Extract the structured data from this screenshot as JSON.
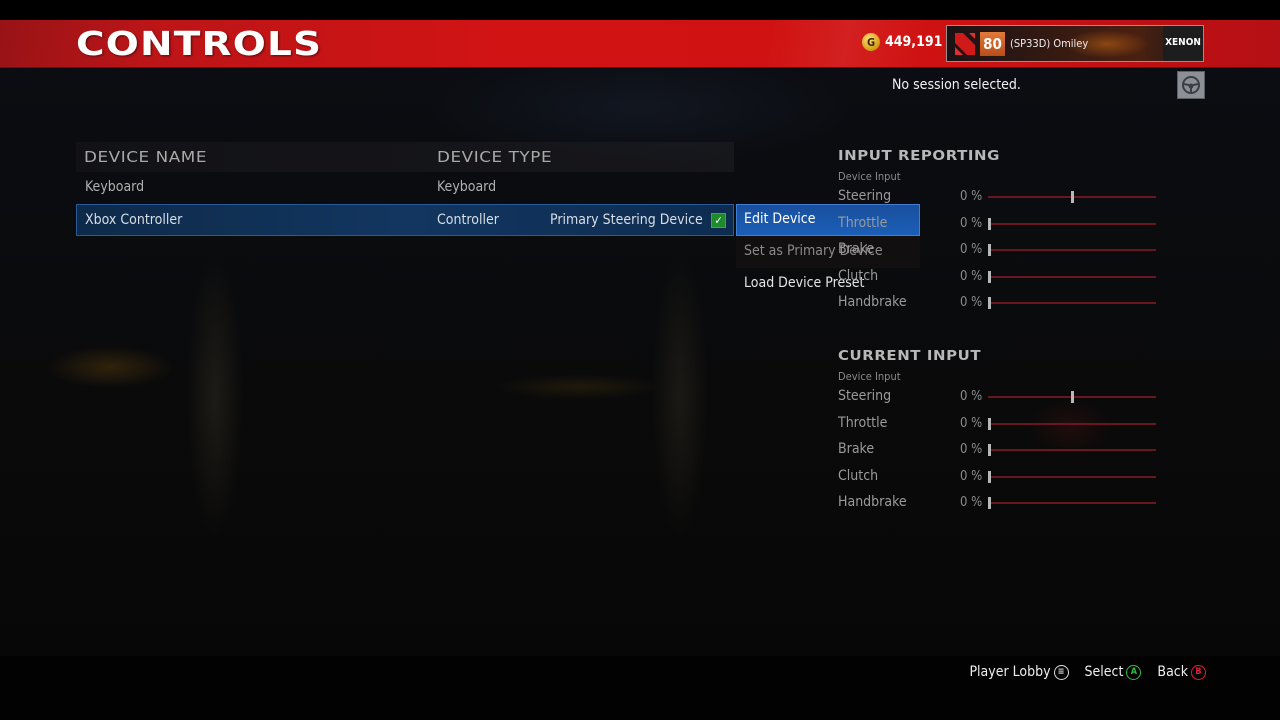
{
  "header": {
    "title": "CONTROLS",
    "credits": "449,191",
    "credits_icon": "G",
    "player": {
      "level": "80",
      "name": "(SP33D) Omiley",
      "club": "XENON"
    },
    "session_status": "No session selected."
  },
  "devices": {
    "columns": [
      "DEVICE NAME",
      "DEVICE TYPE"
    ],
    "rows": [
      {
        "name": "Keyboard",
        "type": "Keyboard",
        "primary": "",
        "selected": false
      },
      {
        "name": "Xbox Controller",
        "type": "Controller",
        "primary": "Primary Steering Device",
        "selected": true
      }
    ],
    "primary_check": "✓"
  },
  "context_menu": {
    "items": [
      {
        "label": "Edit Device",
        "state": "active"
      },
      {
        "label": "Set as Primary Device",
        "state": "disabled"
      },
      {
        "label": "Load Device Preset",
        "state": "normal"
      }
    ]
  },
  "input_reporting": {
    "title": "INPUT REPORTING",
    "subtitle": "Device Input",
    "inputs": [
      {
        "label": "Steering",
        "value": "0 %",
        "level": 0.5
      },
      {
        "label": "Throttle",
        "value": "0 %",
        "level": 0
      },
      {
        "label": "Brake",
        "value": "0 %",
        "level": 0
      },
      {
        "label": "Clutch",
        "value": "0 %",
        "level": 0
      },
      {
        "label": "Handbrake",
        "value": "0 %",
        "level": 0
      }
    ]
  },
  "current_input": {
    "title": "CURRENT INPUT",
    "subtitle": "Device Input",
    "inputs": [
      {
        "label": "Steering",
        "value": "0 %",
        "level": 0.5
      },
      {
        "label": "Throttle",
        "value": "0 %",
        "level": 0
      },
      {
        "label": "Brake",
        "value": "0 %",
        "level": 0
      },
      {
        "label": "Clutch",
        "value": "0 %",
        "level": 0
      },
      {
        "label": "Handbrake",
        "value": "0 %",
        "level": 0
      }
    ]
  },
  "footer": {
    "hints": [
      {
        "label": "Player Lobby",
        "glyph": "≡",
        "kind": "menu"
      },
      {
        "label": "Select",
        "glyph": "A",
        "kind": "a"
      },
      {
        "label": "Back",
        "glyph": "B",
        "kind": "b"
      }
    ]
  },
  "colors": {
    "header_red": "#d21313",
    "selection_blue": "#1b5fb8",
    "track_red": "#6a1520",
    "check_green": "#1e8a2a"
  }
}
